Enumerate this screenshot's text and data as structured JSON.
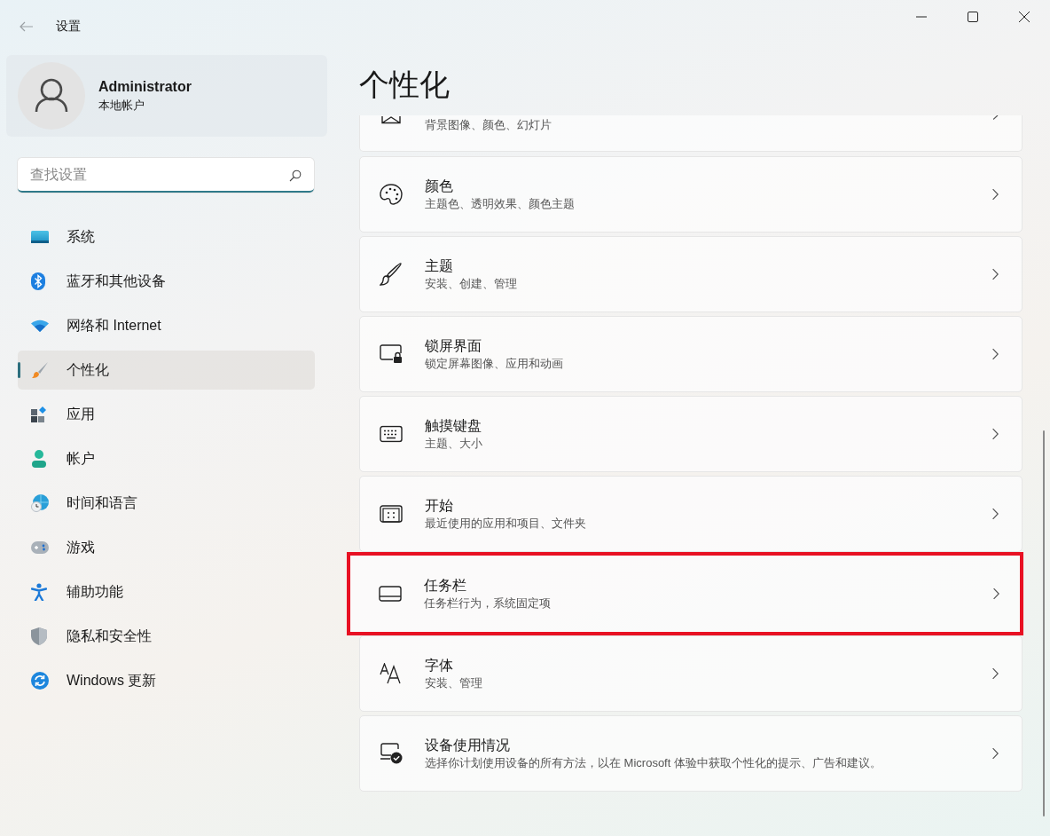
{
  "window": {
    "title": "设置"
  },
  "account": {
    "name": "Administrator",
    "type": "本地帐户"
  },
  "search": {
    "placeholder": "查找设置"
  },
  "nav": [
    {
      "label": "系统",
      "selected": false
    },
    {
      "label": "蓝牙和其他设备",
      "selected": false
    },
    {
      "label": "网络和 Internet",
      "selected": false
    },
    {
      "label": "个性化",
      "selected": true
    },
    {
      "label": "应用",
      "selected": false
    },
    {
      "label": "帐户",
      "selected": false
    },
    {
      "label": "时间和语言",
      "selected": false
    },
    {
      "label": "游戏",
      "selected": false
    },
    {
      "label": "辅助功能",
      "selected": false
    },
    {
      "label": "隐私和安全性",
      "selected": false
    },
    {
      "label": "Windows 更新",
      "selected": false
    }
  ],
  "page": {
    "title": "个性化",
    "items": [
      {
        "kind": "partial",
        "subtitle": "背景图像、颜色、幻灯片",
        "highlighted": false
      },
      {
        "kind": "full",
        "title": "颜色",
        "subtitle": "主题色、透明效果、颜色主题",
        "highlighted": false
      },
      {
        "kind": "full",
        "title": "主题",
        "subtitle": "安装、创建、管理",
        "highlighted": false
      },
      {
        "kind": "full",
        "title": "锁屏界面",
        "subtitle": "锁定屏幕图像、应用和动画",
        "highlighted": false
      },
      {
        "kind": "full",
        "title": "触摸键盘",
        "subtitle": "主题、大小",
        "highlighted": false
      },
      {
        "kind": "full",
        "title": "开始",
        "subtitle": "最近使用的应用和项目、文件夹",
        "highlighted": false
      },
      {
        "kind": "full",
        "title": "任务栏",
        "subtitle": "任务栏行为，系统固定项",
        "highlighted": true
      },
      {
        "kind": "full",
        "title": "字体",
        "subtitle": "安装、管理",
        "highlighted": false
      },
      {
        "kind": "full",
        "title": "设备使用情况",
        "subtitle": "选择你计划使用设备的所有方法，以在 Microsoft 体验中获取个性化的提示、广告和建议。",
        "highlighted": false
      }
    ]
  }
}
